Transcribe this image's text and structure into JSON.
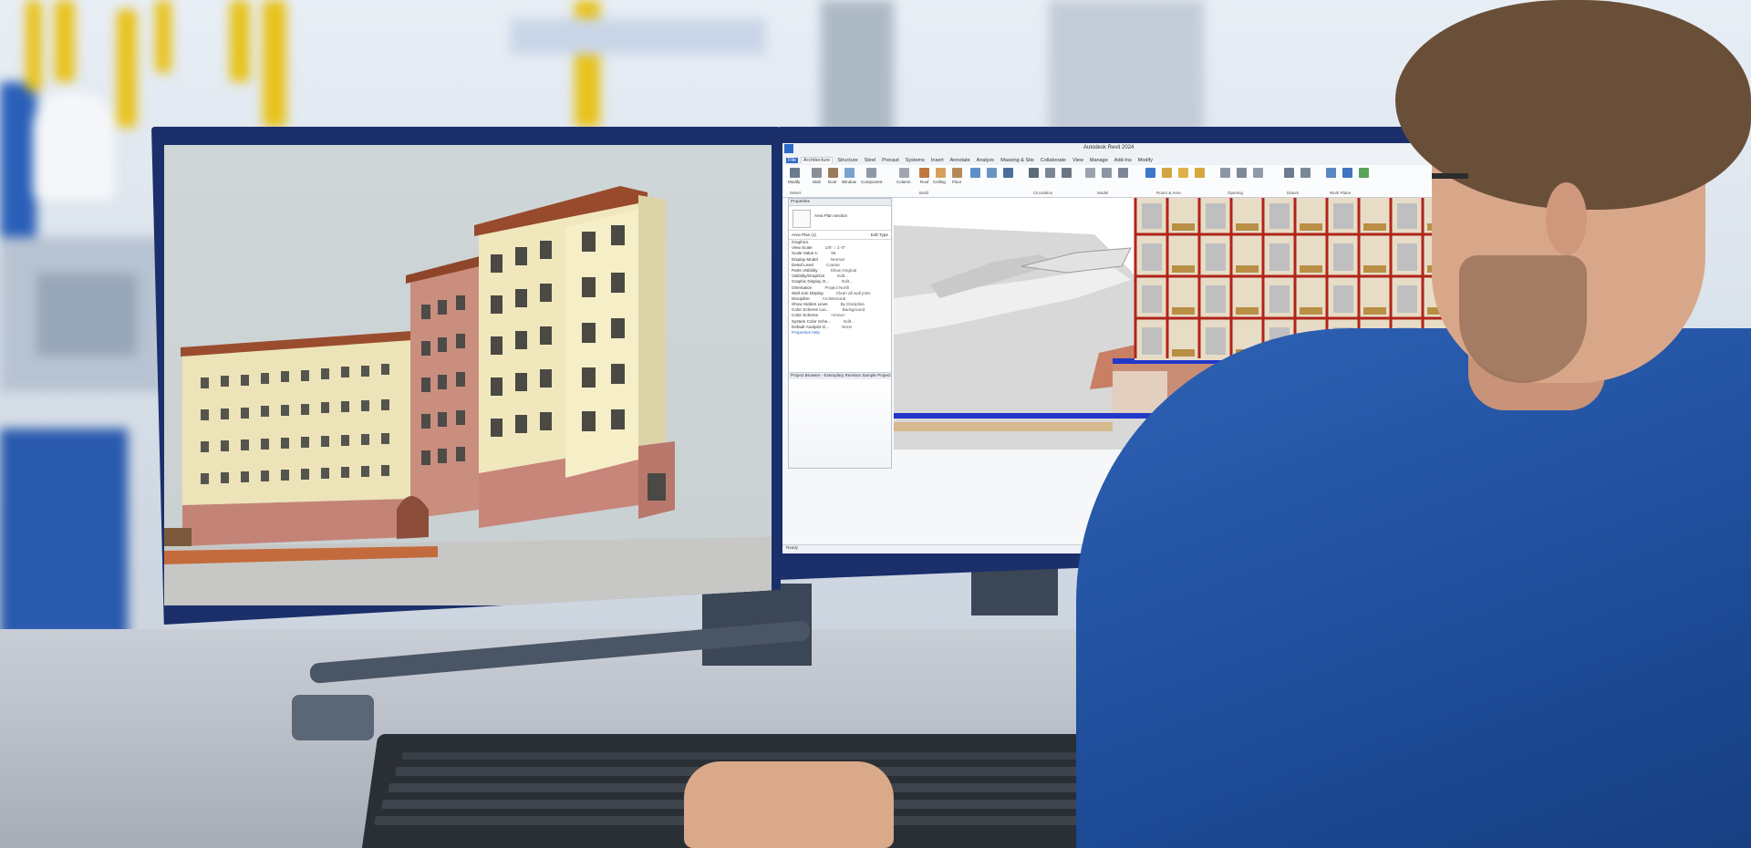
{
  "left_screen": {
    "content": "3D rendering of a multi-story hotel building"
  },
  "revit": {
    "window_title": "Autodesk Revit 2024",
    "tabs": [
      "File",
      "Architecture",
      "Structure",
      "Steel",
      "Precast",
      "Systems",
      "Insert",
      "Annotate",
      "Analyze",
      "Massing & Site",
      "Collaborate",
      "View",
      "Manage",
      "Add-Ins",
      "Modify"
    ],
    "ribbon_tools": [
      "Modify",
      "Wall",
      "Door",
      "Window",
      "Component",
      "Column",
      "Roof",
      "Ceiling",
      "Floor",
      "Curtain System",
      "Curtain Grid",
      "Mullion",
      "Railing",
      "Ramp",
      "Stair",
      "Model Text",
      "Model Line",
      "Model Group",
      "Room",
      "Room Separator",
      "Tag Room",
      "Area",
      "Area Boundary",
      "Tag Area",
      "By Face",
      "Shaft",
      "Wall",
      "Vertical",
      "Dormer",
      "Level",
      "Grid",
      "Set",
      "Show",
      "Ref Plane",
      "Viewer"
    ],
    "panels": [
      "Select",
      "Build",
      "Circulation",
      "Model",
      "Room & Area",
      "Opening",
      "Datum",
      "Work Plane"
    ],
    "properties": {
      "header": "Properties",
      "type_name": "Area Plan Section",
      "edit_type": "Edit Type",
      "view_selector": "Area Plan (1)",
      "rows": [
        [
          "Graphics",
          ""
        ],
        [
          "View Scale",
          "1/8\" = 1'-0\""
        ],
        [
          "Scale Value 1:",
          "96"
        ],
        [
          "Display Model",
          "Normal"
        ],
        [
          "Detail Level",
          "Coarse"
        ],
        [
          "Parts Visibility",
          "Show Original"
        ],
        [
          "Visibility/Graphics",
          "Edit..."
        ],
        [
          "Graphic Display O...",
          "Edit..."
        ],
        [
          "Orientation",
          "Project North"
        ],
        [
          "Wall Join Display",
          "Clean all wall joins"
        ],
        [
          "Discipline",
          "Architectural"
        ],
        [
          "Show Hidden Lines",
          "By Discipline"
        ],
        [
          "Color Scheme Loc...",
          "Background"
        ],
        [
          "Color Scheme",
          "<none>"
        ],
        [
          "System Color Sche...",
          "Edit..."
        ],
        [
          "Default Analysis D...",
          "None"
        ]
      ],
      "apply_link": "Properties help",
      "browser_header": "Project Browser - Exemplary Revision Sample Project"
    },
    "status_text": "Ready"
  }
}
